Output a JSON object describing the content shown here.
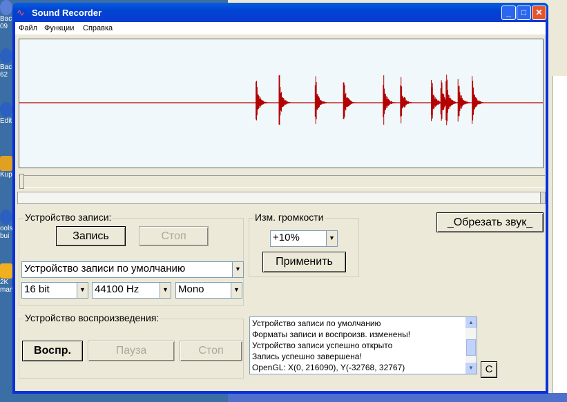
{
  "desktop": {
    "icons": [
      {
        "label": "Bac\n09",
        "name": "desktop-icon-1"
      },
      {
        "label": "Bac\n62",
        "name": "desktop-icon-2"
      },
      {
        "label": "Edit",
        "name": "desktop-icon-3"
      },
      {
        "label": "Kup",
        "name": "desktop-icon-4"
      },
      {
        "label": "ools\nbui",
        "name": "desktop-icon-5"
      },
      {
        "label": "2K\nman",
        "name": "desktop-icon-6"
      }
    ]
  },
  "window": {
    "title": "Sound Recorder",
    "title_icon": "waveform-icon",
    "controls": {
      "minimize": "_",
      "maximize": "□",
      "close": "✕"
    }
  },
  "menu": {
    "file": "Файл",
    "functions": "Функции",
    "help": "Справка"
  },
  "waveform": {
    "color": "#b30000",
    "background": "#f0f8fb",
    "bursts": [
      0.452,
      0.496,
      0.565,
      0.619,
      0.695,
      0.728,
      0.787,
      0.805,
      0.815,
      0.838,
      0.865
    ]
  },
  "record_group": {
    "title": "Устройство записи:",
    "record_button": "Запись",
    "stop_button": "Стоп",
    "device": "Устройство записи по умолчанию",
    "bits": "16 bit",
    "rate": "44100 Hz",
    "channels": "Mono"
  },
  "volume_group": {
    "title": "Изм. громкости",
    "value": "+10%",
    "apply_button": "Применить"
  },
  "trim_button": "_Обрезать звук_",
  "playback_group": {
    "title": "Устройство воспроизведения:",
    "play_button": "Воспр.",
    "pause_button": "Пауза",
    "stop_button": "Стоп"
  },
  "log": {
    "lines": [
      "Устройство записи по умолчанию",
      "Форматы записи и воспроизв. изменены!",
      "Устройство записи успешно открыто",
      "Запись успешно завершена!",
      "OpenGL: X(0, 216090), Y(-32768, 32767)"
    ]
  },
  "clear_button": "C"
}
